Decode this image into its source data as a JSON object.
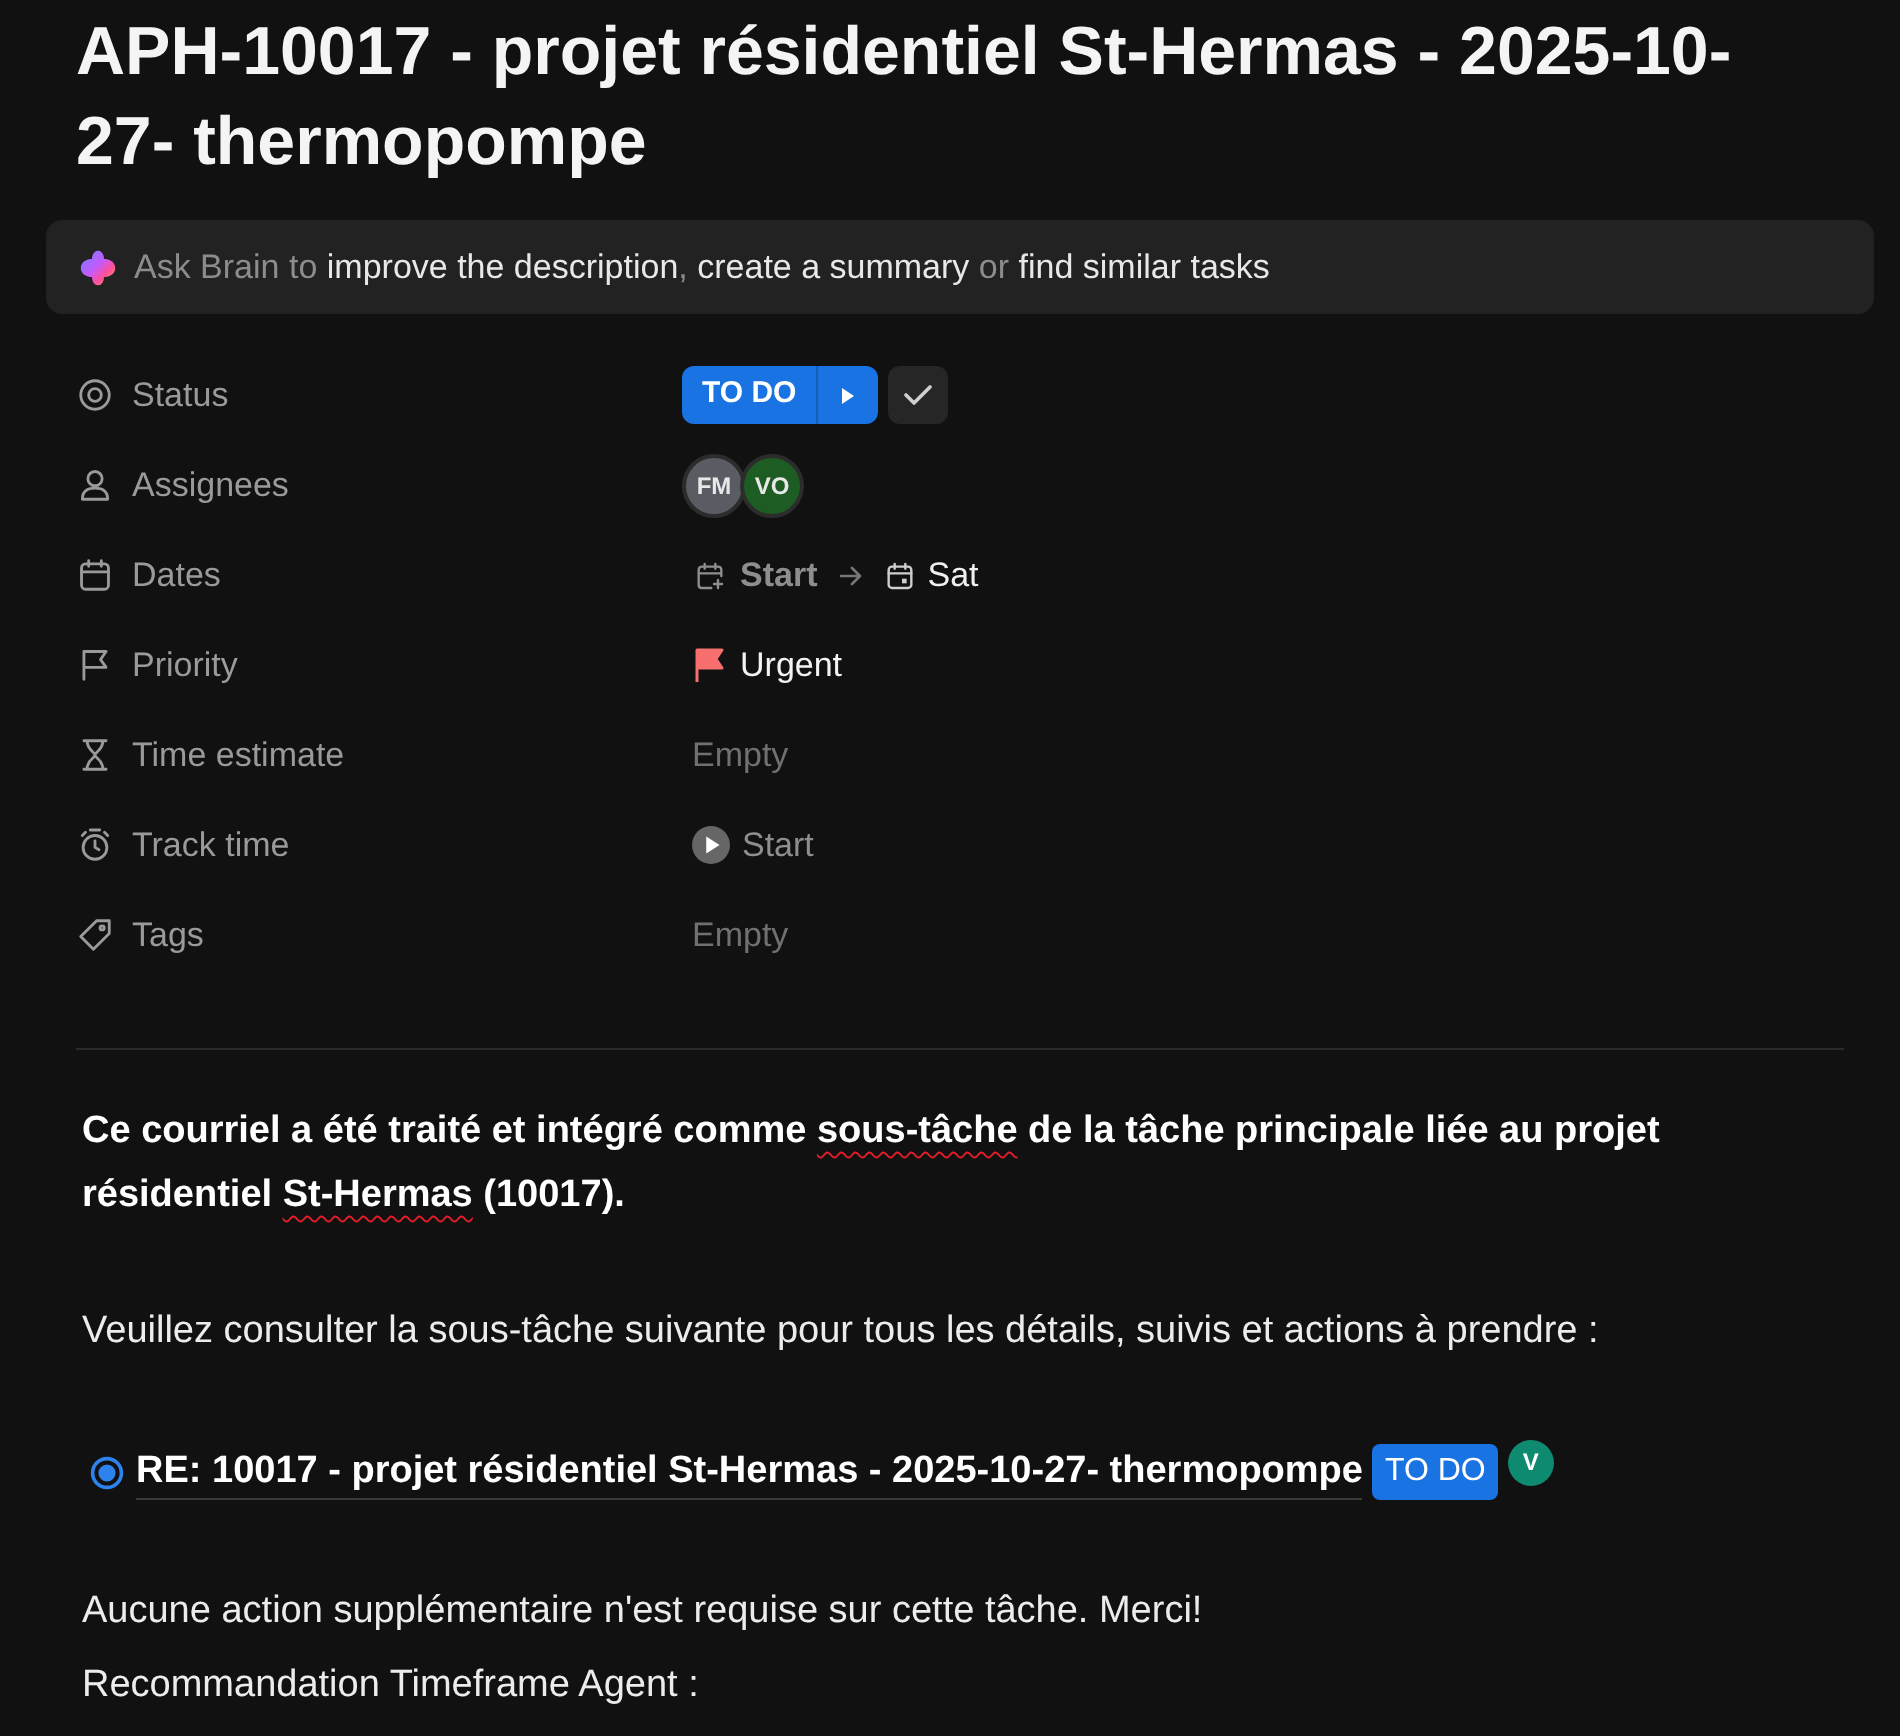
{
  "task": {
    "title": "APH-10017 - projet résidentiel St-Hermas - 2025-10-27- thermopompe"
  },
  "ai_bar": {
    "parts": [
      {
        "text": "Ask Brain to",
        "kind": "prompt"
      },
      {
        "text": "improve the description",
        "kind": "action"
      },
      {
        "text": ",",
        "kind": "prompt"
      },
      {
        "text": "create a summary",
        "kind": "action"
      },
      {
        "text": "or",
        "kind": "prompt"
      },
      {
        "text": "find similar tasks",
        "kind": "action"
      }
    ]
  },
  "properties": [
    {
      "label": "Status",
      "kind": "status",
      "value": "TO DO"
    },
    {
      "label": "Assignees",
      "kind": "assignees",
      "assignees": [
        {
          "initials": "FM",
          "color": "#595c62"
        },
        {
          "initials": "VO",
          "color": "#1d5c23"
        }
      ]
    },
    {
      "label": "Dates",
      "kind": "dates",
      "start": "Start",
      "due": "Sat"
    },
    {
      "label": "Priority",
      "kind": "priority",
      "value": "Urgent"
    },
    {
      "label": "Time estimate",
      "kind": "estimate",
      "placeholder": "Empty"
    },
    {
      "label": "Track time",
      "kind": "timer",
      "value": "Start"
    },
    {
      "label": "Tags",
      "kind": "tags",
      "placeholder": "Empty"
    }
  ],
  "description": [
    {
      "kind": "paragraph",
      "bold": true,
      "lines": [
        [
          {
            "text": "Ce courriel a été traité et intégré comme ",
            "misspelled": false
          },
          {
            "text": "sous-tâche",
            "misspelled": true
          },
          {
            "text": " de la tâche principale liée au projet résidentiel ",
            "misspelled": false
          },
          {
            "text": "St-Hermas",
            "misspelled": true
          },
          {
            "text": " (10017).",
            "misspelled": false
          }
        ]
      ]
    },
    {
      "kind": "paragraph",
      "bold": false,
      "lines": [
        [
          {
            "text": "Veuillez consulter la sous-tâche suivante pour tous les détails, suivis et actions à prendre :",
            "misspelled": false
          }
        ]
      ]
    },
    {
      "kind": "task_link",
      "text": "RE: 10017 - projet résidentiel St-Hermas - 2025-10-27- thermopompe",
      "status": "TO DO",
      "assignee": {
        "initials": "V",
        "color": "#0e8a70"
      }
    },
    {
      "kind": "paragraph",
      "bold": false,
      "lines": [
        [
          {
            "text": "Aucune action supplémentaire n'est requise sur cette tâche. Merci!",
            "misspelled": false
          }
        ],
        [
          {
            "text": "Recommandation Timeframe Agent :",
            "misspelled": false
          }
        ]
      ]
    }
  ]
}
